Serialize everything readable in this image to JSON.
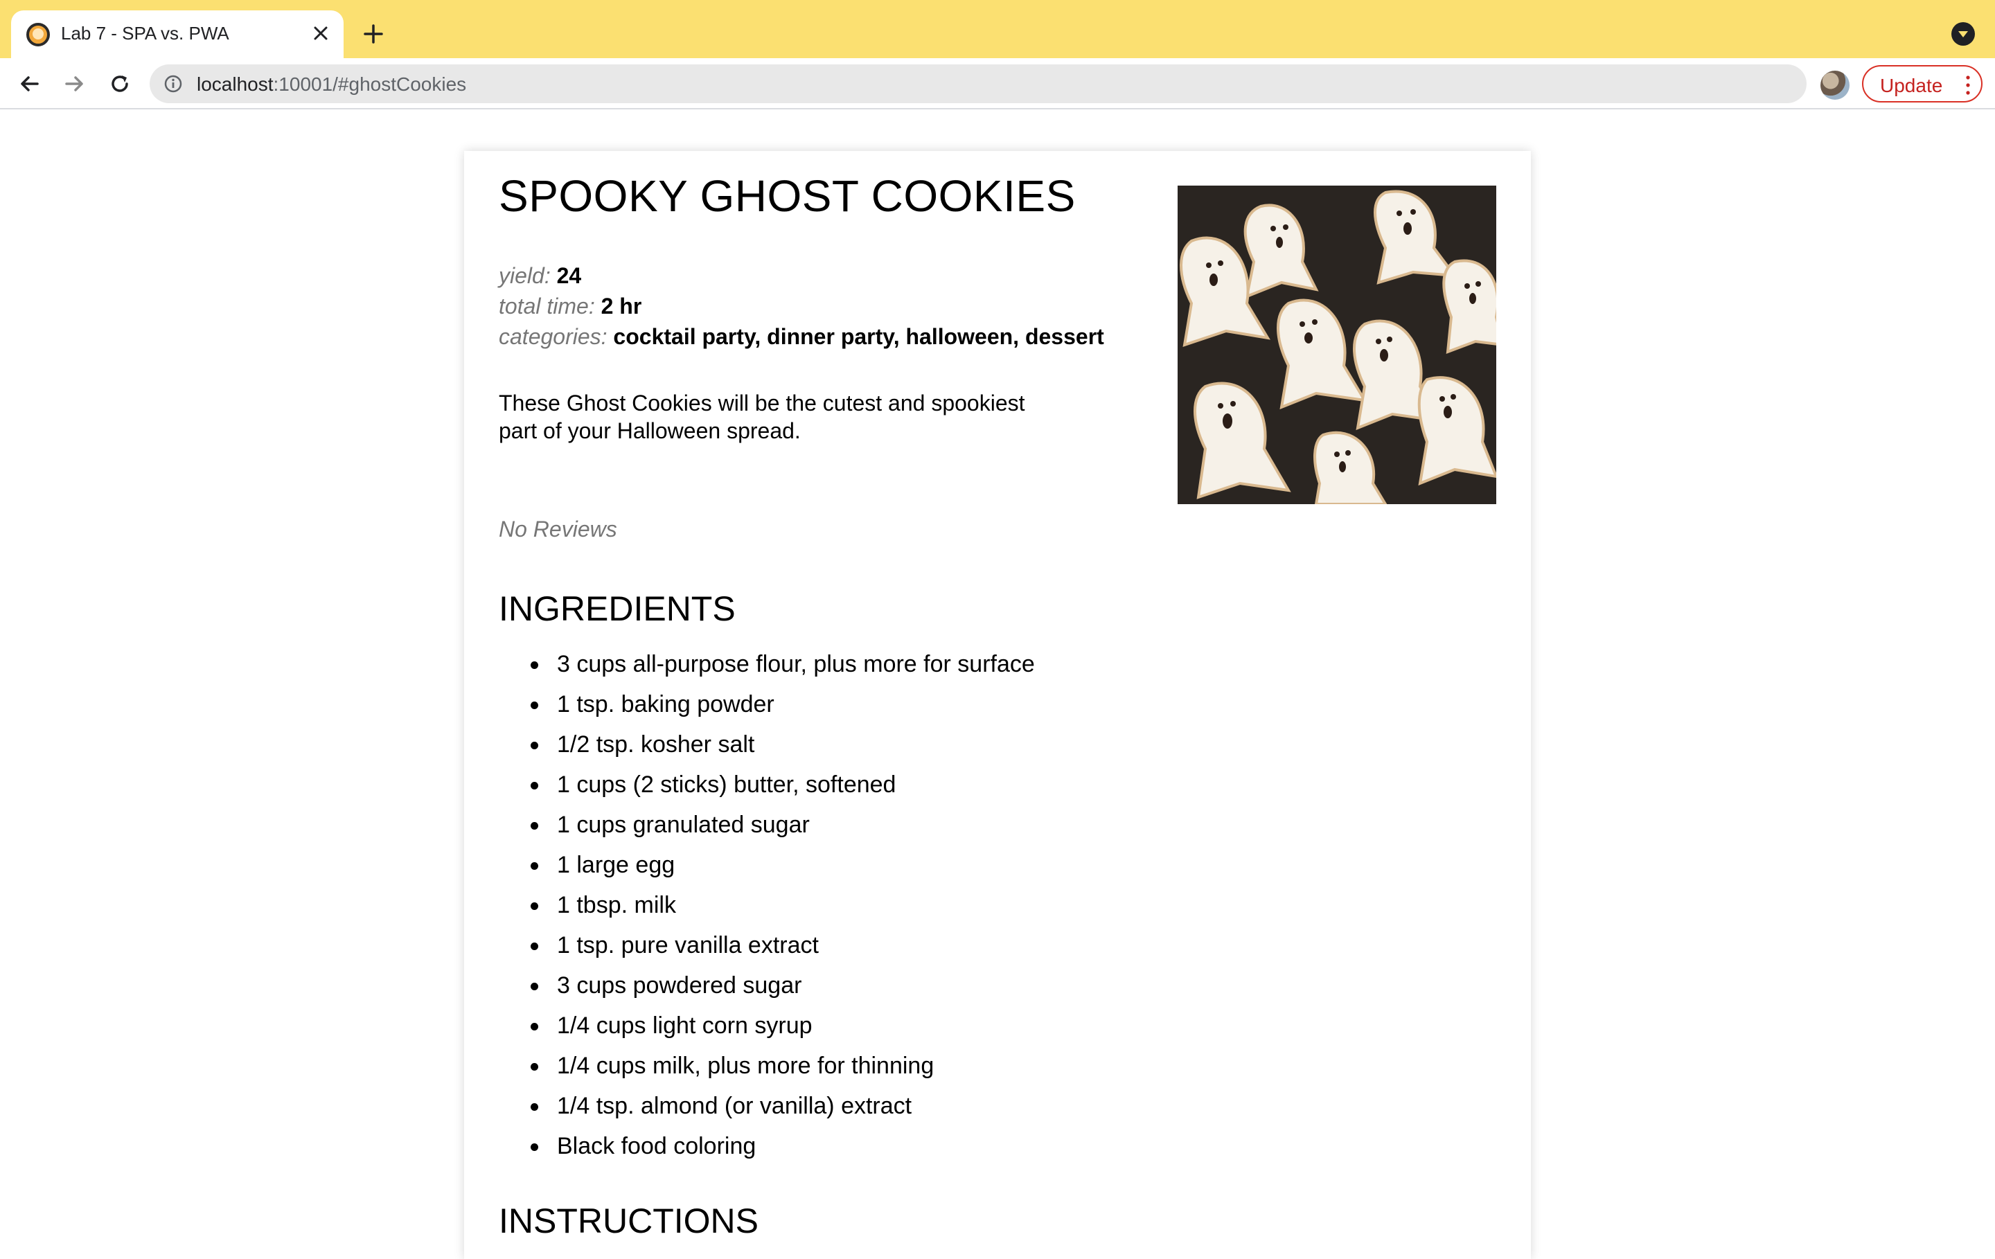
{
  "browser": {
    "tab_title": "Lab 7 - SPA vs. PWA",
    "url_host": "localhost",
    "url_rest": ":10001/#ghostCookies",
    "update_label": "Update",
    "accent": "#fbe071"
  },
  "recipe": {
    "title": "SPOOKY GHOST COOKIES",
    "yield_label": "yield:",
    "yield_value": "24",
    "time_label": "total time:",
    "time_value": "2 hr",
    "categories_label": "categories:",
    "categories_value": "cocktail party, dinner party, halloween, dessert",
    "description": "These Ghost Cookies will be the cutest and spookiest part of your Halloween spread.",
    "reviews": "No Reviews",
    "ingredients_heading": "INGREDIENTS",
    "ingredients": [
      "3 cups all-purpose flour, plus more for surface",
      "1 tsp. baking powder",
      "1/2 tsp. kosher salt",
      "1 cups (2 sticks) butter, softened",
      "1 cups granulated sugar",
      "1 large egg",
      "1 tbsp. milk",
      "1 tsp. pure vanilla extract",
      "3 cups powdered sugar",
      "1/4 cups light corn syrup",
      "1/4 cups milk, plus more for thinning",
      "1/4 tsp. almond (or vanilla) extract",
      "Black food coloring"
    ],
    "instructions_heading": "INSTRUCTIONS"
  }
}
